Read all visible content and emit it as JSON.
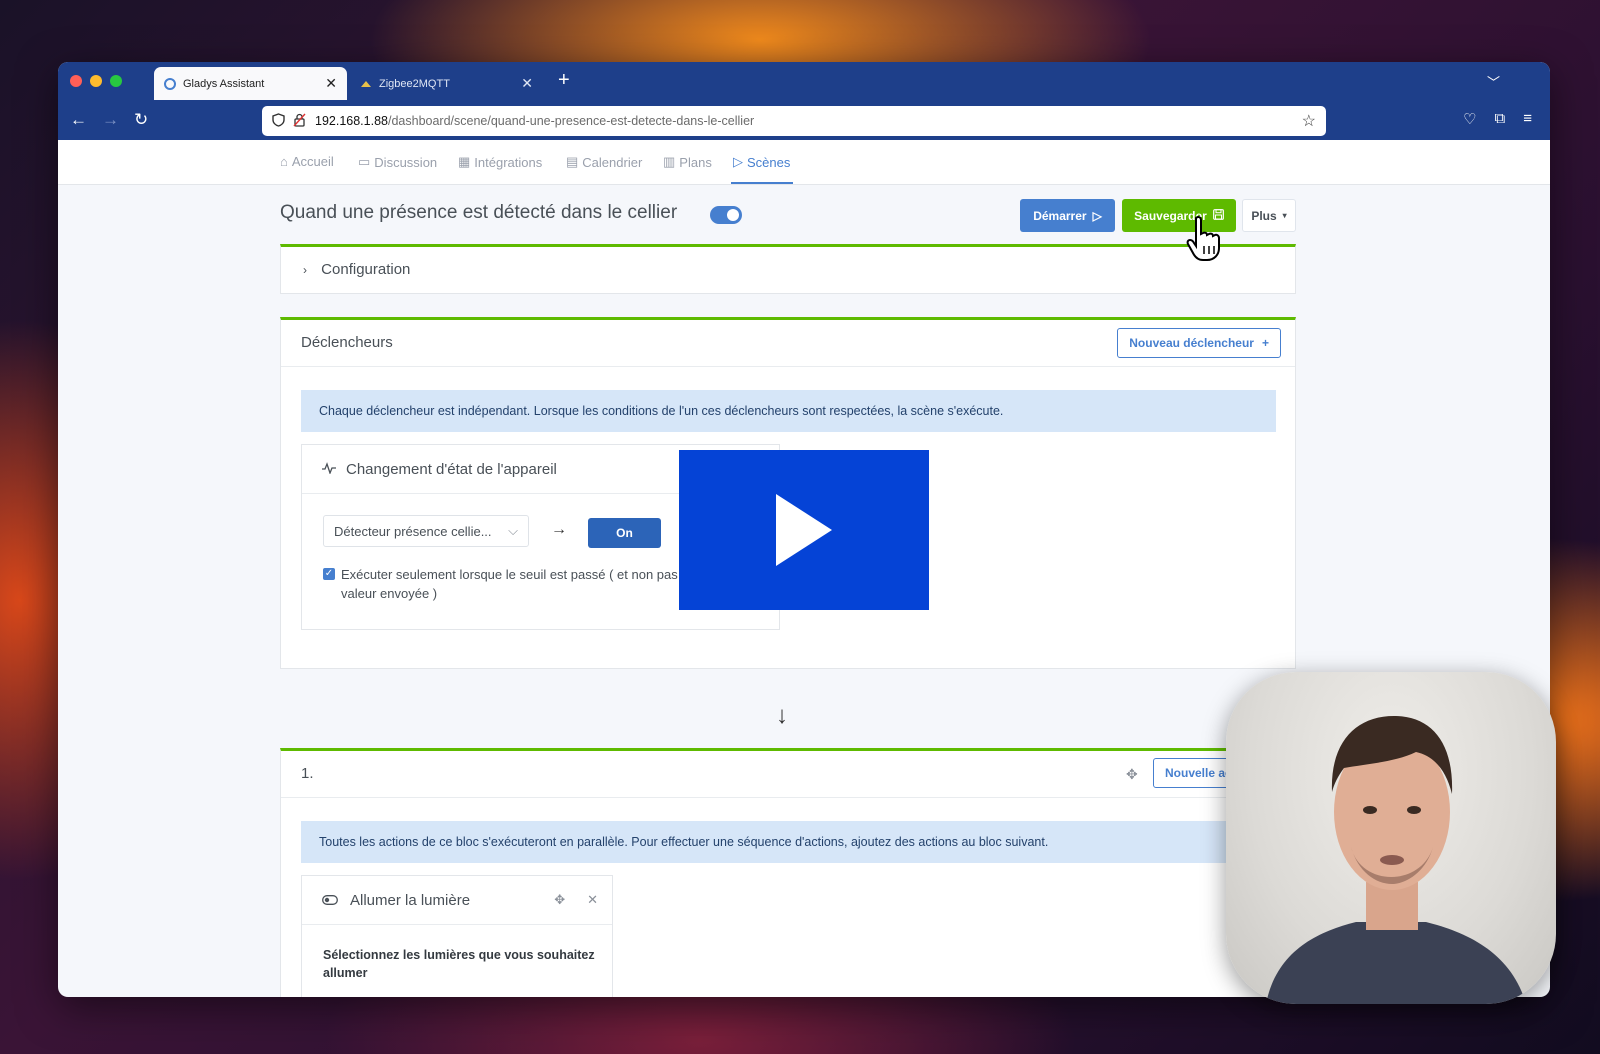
{
  "browser": {
    "tabs": [
      {
        "title": "Gladys Assistant",
        "active": true
      },
      {
        "title": "Zigbee2MQTT",
        "active": false
      }
    ],
    "url_host": "192.168.1.88",
    "url_path": "/dashboard/scene/quand-une-presence-est-detecte-dans-le-cellier"
  },
  "nav": {
    "items": [
      {
        "label": "Accueil",
        "icon": "home-icon"
      },
      {
        "label": "Discussion",
        "icon": "chat-icon"
      },
      {
        "label": "Intégrations",
        "icon": "grid-icon"
      },
      {
        "label": "Calendrier",
        "icon": "calendar-icon"
      },
      {
        "label": "Plans",
        "icon": "map-icon"
      },
      {
        "label": "Scènes",
        "icon": "play-icon",
        "active": true
      }
    ]
  },
  "scene": {
    "title": "Quand une présence est détecté dans le cellier",
    "enabled": true,
    "buttons": {
      "start": "Démarrer",
      "save": "Sauvegarder",
      "more": "Plus"
    }
  },
  "configuration": {
    "label": "Configuration"
  },
  "triggers": {
    "title": "Déclencheurs",
    "new_button": "Nouveau déclencheur",
    "info": "Chaque déclencheur est indépendant. Lorsque les conditions de l'un ces déclencheurs sont respectées, la scène s'exécute.",
    "card": {
      "title": "Changement d'état de l'appareil",
      "device": "Détecteur présence cellie...",
      "value_button": "On",
      "checkbox_label": "Exécuter seulement lorsque le seuil est passé ( et non pas à chaque valeur envoyée )",
      "checked": true
    }
  },
  "block": {
    "number": "1.",
    "new_button": "Nouvelle action",
    "info": "Toutes les actions de ce bloc s'exécuteront en parallèle. Pour effectuer une séquence d'actions, ajoutez des actions au bloc suivant.",
    "action": {
      "title": "Allumer la lumière",
      "description": "Sélectionnez les lumières que vous souhaitez allumer"
    }
  },
  "colors": {
    "primary": "#467fcf",
    "success": "#5eba00",
    "browser_chrome": "#1e3f8a",
    "video_overlay": "#0543d6"
  }
}
